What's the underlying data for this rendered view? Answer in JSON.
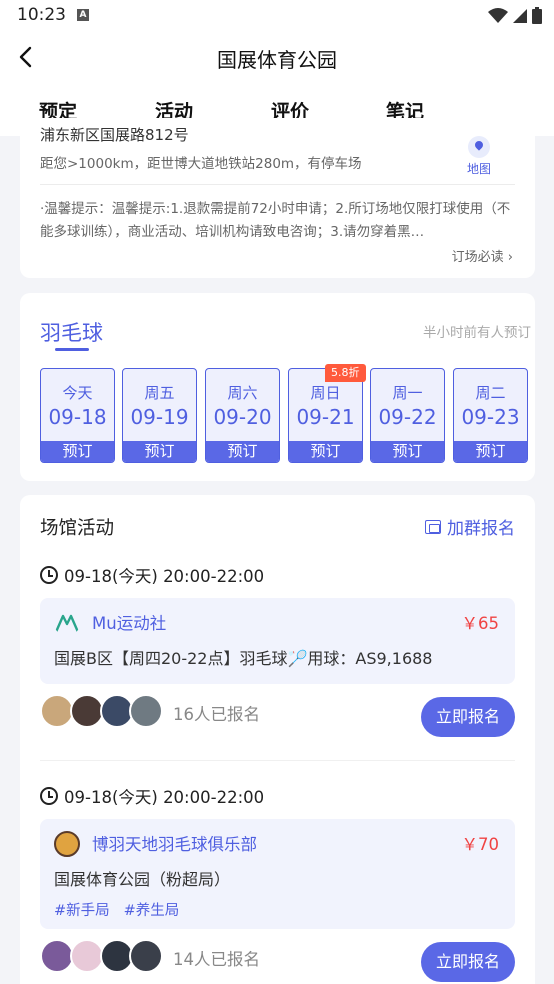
{
  "status_bar": {
    "time": "10:23",
    "notification_letter": "A"
  },
  "nav": {
    "title": "国展体育公园"
  },
  "tabs": [
    "预定",
    "活动",
    "评价",
    "笔记"
  ],
  "venue": {
    "address": "浦东新区国展路812号",
    "distance": "距您>1000km，距世博大道地铁站280m，有停车场",
    "map_label": "地图",
    "tip": "·温馨提示：温馨提示:1.退款需提前72小时申请；2.所订场地仅限打球使用（不能多球训练），商业活动、培训机构请致电咨询；3.请勿穿着黑…",
    "must_read": "订场必读 ›"
  },
  "booking": {
    "sport": "羽毛球",
    "hint": "半小时前有人预订",
    "days": [
      {
        "weekday": "今天",
        "date": "09-18",
        "action": "预订"
      },
      {
        "weekday": "周五",
        "date": "09-19",
        "action": "预订"
      },
      {
        "weekday": "周六",
        "date": "09-20",
        "action": "预订"
      },
      {
        "weekday": "周日",
        "date": "09-21",
        "action": "预订",
        "discount": "5.8折"
      },
      {
        "weekday": "周一",
        "date": "09-22",
        "action": "预订"
      },
      {
        "weekday": "周二",
        "date": "09-23",
        "action": "预订"
      }
    ]
  },
  "activities": {
    "title": "场馆活动",
    "join_group": "加群报名",
    "items": [
      {
        "time": "09-18(今天) 20:00-22:00",
        "club": "Mu运动社",
        "price": "￥65",
        "desc": "国展B区【周四20-22点】羽毛球🏸用球：AS9,1688",
        "tags": [],
        "signed": "16人已报名",
        "button": "立即报名"
      },
      {
        "time": "09-18(今天) 20:00-22:00",
        "club": "博羽天地羽毛球俱乐部",
        "price": "￥70",
        "desc": "国展体育公园（粉超局）",
        "tags": [
          "#新手局",
          "#养生局"
        ],
        "signed": "14人已报名",
        "button": "立即报名"
      }
    ]
  },
  "colors": {
    "primary": "#4f5fe0",
    "button": "#5a68e6",
    "price": "#f04343",
    "discount": "#ff5a3c",
    "background": "#f3f4f8"
  }
}
